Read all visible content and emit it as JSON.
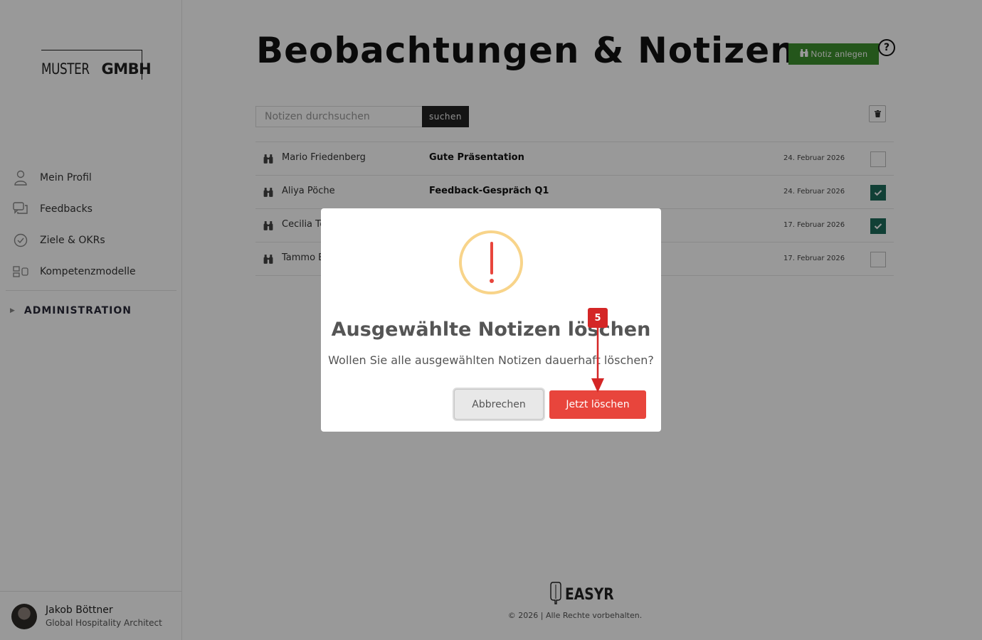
{
  "sidebar": {
    "logo": {
      "thin": "MUSTER",
      "bold": "GMBH"
    },
    "items": [
      {
        "label": "Mein Profil",
        "icon": "user-icon"
      },
      {
        "label": "Feedbacks",
        "icon": "chat-bubbles-icon"
      },
      {
        "label": "Ziele & OKRs",
        "icon": "check-circle-icon"
      },
      {
        "label": "Kompetenzmodelle",
        "icon": "competence-model-icon"
      }
    ],
    "admin": {
      "caret": "▶",
      "label": "ADMINISTRATION"
    },
    "user": {
      "name": "Jakob Böttner",
      "role": "Global Hospitality Architect"
    }
  },
  "main": {
    "title": "Beobachtungen & Notizen",
    "add_button": "Notiz anlegen",
    "help": "?",
    "search": {
      "placeholder": "Notizen durchsuchen",
      "button": "suchen"
    },
    "rows": [
      {
        "name": "Mario Friedenberg",
        "title": "Gute Präsentation",
        "date": "24. Februar 2026",
        "checked": false
      },
      {
        "name": "Aliya Pöche",
        "title": "Feedback-Gespräch Q1",
        "date": "24. Februar 2026",
        "checked": true
      },
      {
        "name": "Cecilia Tö",
        "title": "",
        "date": "17. Februar 2026",
        "checked": true
      },
      {
        "name": "Tammo E",
        "title": "",
        "date": "17. Februar 2026",
        "checked": false
      }
    ]
  },
  "footer": {
    "brand": "EASYR",
    "copyright": "© 2026 | Alle Rechte vorbehalten."
  },
  "modal": {
    "title": "Ausgewählte Notizen löschen",
    "text": "Wollen Sie alle ausgewählten Notizen dauerhaft löschen?",
    "cancel": "Abbrechen",
    "confirm": "Jetzt löschen"
  },
  "annotation": {
    "step": "5"
  },
  "colors": {
    "primary_green": "#3d8f2d",
    "check_teal": "#1d6b5a",
    "danger": "#e8453c",
    "warning_ring": "#f8d48a"
  }
}
